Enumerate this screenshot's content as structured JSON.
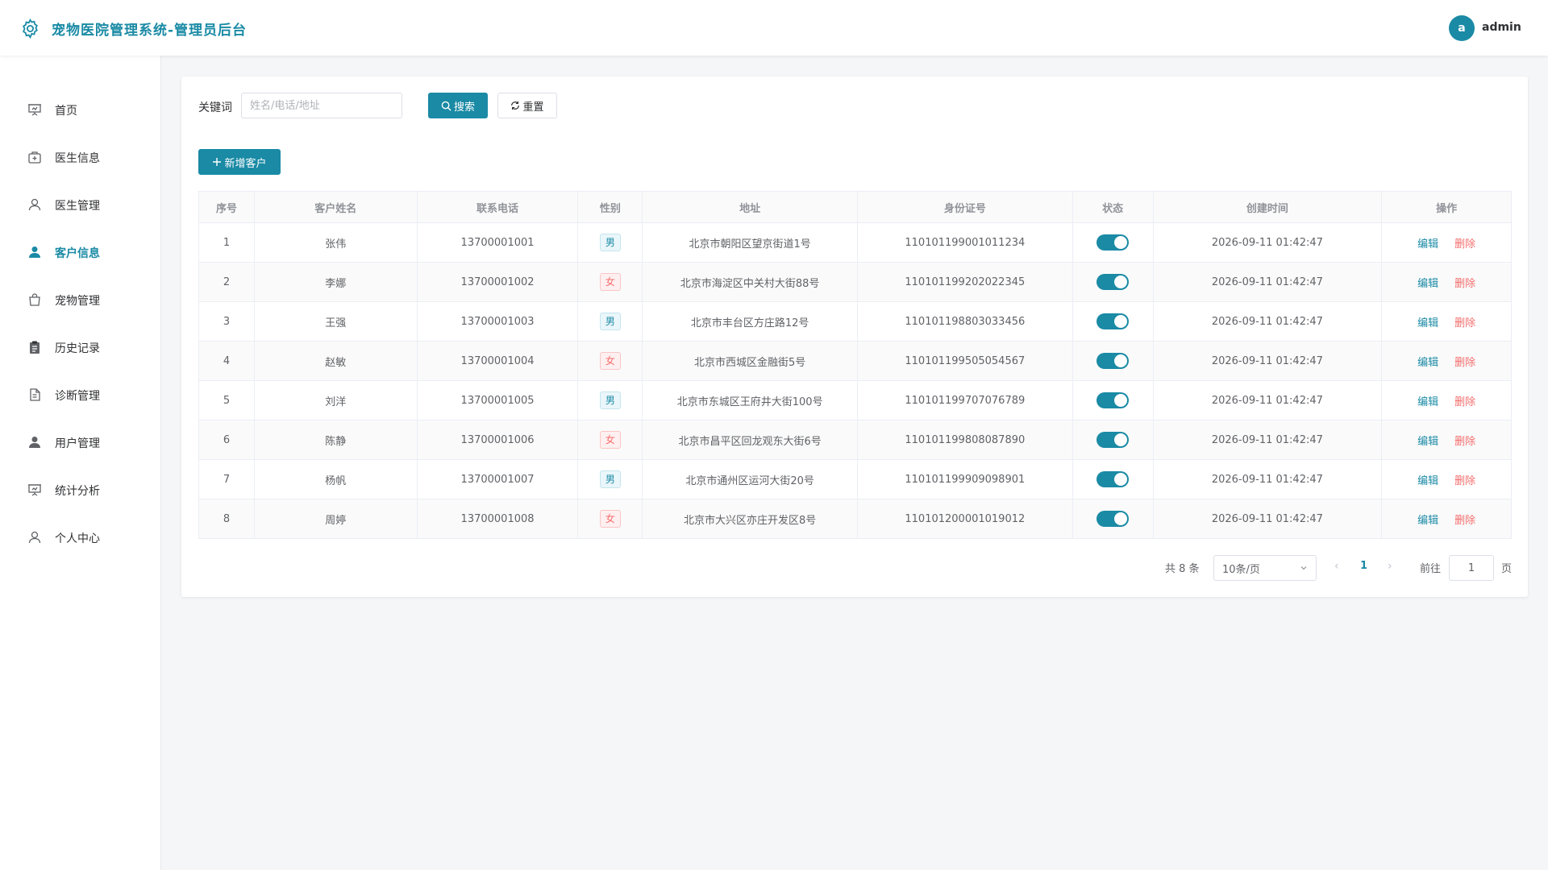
{
  "header": {
    "title": "宠物医院管理系统-管理员后台",
    "avatar_letter": "a",
    "username": "admin"
  },
  "sidebar": {
    "items": [
      {
        "label": "首页",
        "icon": "presentation-icon"
      },
      {
        "label": "医生信息",
        "icon": "medical-kit-icon"
      },
      {
        "label": "医生管理",
        "icon": "user-outline-icon"
      },
      {
        "label": "客户信息",
        "icon": "user-filled-icon",
        "active": true
      },
      {
        "label": "宠物管理",
        "icon": "shopping-bag-icon"
      },
      {
        "label": "历史记录",
        "icon": "clipboard-icon"
      },
      {
        "label": "诊断管理",
        "icon": "document-icon"
      },
      {
        "label": "用户管理",
        "icon": "user-filled-icon"
      },
      {
        "label": "统计分析",
        "icon": "presentation-icon"
      },
      {
        "label": "个人中心",
        "icon": "user-outline-icon"
      }
    ]
  },
  "search": {
    "label": "关键词",
    "placeholder": "姓名/电话/地址",
    "value": "",
    "search_label": "搜索",
    "reset_label": "重置"
  },
  "toolbar": {
    "add_label": "新增客户"
  },
  "table": {
    "columns": [
      "序号",
      "客户姓名",
      "联系电话",
      "性别",
      "地址",
      "身份证号",
      "状态",
      "创建时间",
      "操作"
    ],
    "edit_label": "编辑",
    "delete_label": "删除",
    "rows": [
      {
        "index": "1",
        "name": "张伟",
        "phone": "13700001001",
        "gender": "男",
        "address": "北京市朝阳区望京街道1号",
        "id_number": "110101199001011234",
        "status": true,
        "created": "2026-09-11 01:42:47"
      },
      {
        "index": "2",
        "name": "李娜",
        "phone": "13700001002",
        "gender": "女",
        "address": "北京市海淀区中关村大街88号",
        "id_number": "110101199202022345",
        "status": true,
        "created": "2026-09-11 01:42:47"
      },
      {
        "index": "3",
        "name": "王强",
        "phone": "13700001003",
        "gender": "男",
        "address": "北京市丰台区方庄路12号",
        "id_number": "110101198803033456",
        "status": true,
        "created": "2026-09-11 01:42:47"
      },
      {
        "index": "4",
        "name": "赵敏",
        "phone": "13700001004",
        "gender": "女",
        "address": "北京市西城区金融街5号",
        "id_number": "110101199505054567",
        "status": true,
        "created": "2026-09-11 01:42:47"
      },
      {
        "index": "5",
        "name": "刘洋",
        "phone": "13700001005",
        "gender": "男",
        "address": "北京市东城区王府井大街100号",
        "id_number": "110101199707076789",
        "status": true,
        "created": "2026-09-11 01:42:47"
      },
      {
        "index": "6",
        "name": "陈静",
        "phone": "13700001006",
        "gender": "女",
        "address": "北京市昌平区回龙观东大街6号",
        "id_number": "110101199808087890",
        "status": true,
        "created": "2026-09-11 01:42:47"
      },
      {
        "index": "7",
        "name": "杨帆",
        "phone": "13700001007",
        "gender": "男",
        "address": "北京市通州区运河大街20号",
        "id_number": "110101199909098901",
        "status": true,
        "created": "2026-09-11 01:42:47"
      },
      {
        "index": "8",
        "name": "周婷",
        "phone": "13700001008",
        "gender": "女",
        "address": "北京市大兴区亦庄开发区8号",
        "id_number": "110101200001019012",
        "status": true,
        "created": "2026-09-11 01:42:47"
      }
    ]
  },
  "pagination": {
    "total_text": "共 8 条",
    "page_size": "10条/页",
    "current_page": "1",
    "goto_label": "前往",
    "goto_value": "1",
    "page_suffix": "页"
  },
  "colors": {
    "primary": "#1a8aa5",
    "danger": "#f56c6c"
  }
}
